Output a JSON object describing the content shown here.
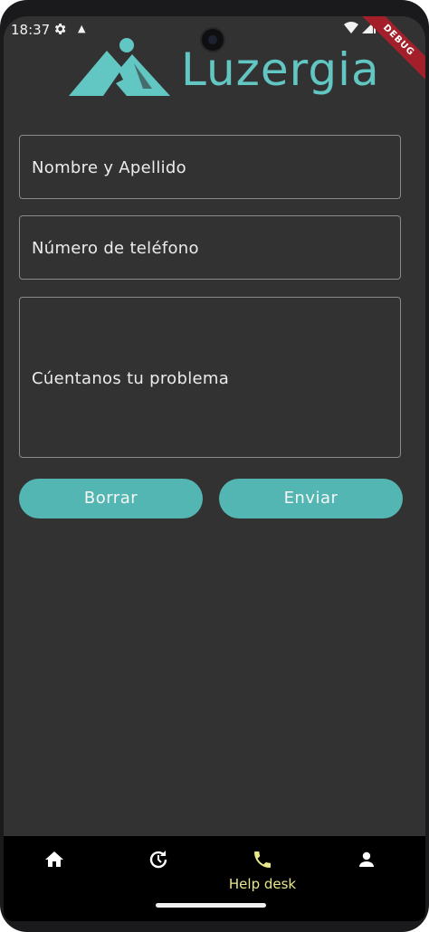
{
  "status_bar": {
    "time": "18:37",
    "left_icons": [
      "gear-icon",
      "a-notification-icon"
    ],
    "right_icons": [
      "wifi-icon",
      "signal-icon"
    ]
  },
  "debug_banner": "DEBUG",
  "logo": {
    "text": "Luzergia"
  },
  "form": {
    "name_placeholder": "Nombre y Apellido",
    "phone_placeholder": "Número de teléfono",
    "problem_placeholder": "Cúentanos tu problema"
  },
  "buttons": {
    "clear": "Borrar",
    "send": "Enviar"
  },
  "nav": {
    "items": [
      {
        "icon": "home-icon",
        "label": ""
      },
      {
        "icon": "history-icon",
        "label": ""
      },
      {
        "icon": "phone-icon",
        "label": "Help desk",
        "active": true
      },
      {
        "icon": "person-icon",
        "label": ""
      }
    ]
  },
  "colors": {
    "background": "#333233",
    "accent": "#53b6b3",
    "nav_active": "#e8e78c",
    "nav_bg": "#000000"
  }
}
